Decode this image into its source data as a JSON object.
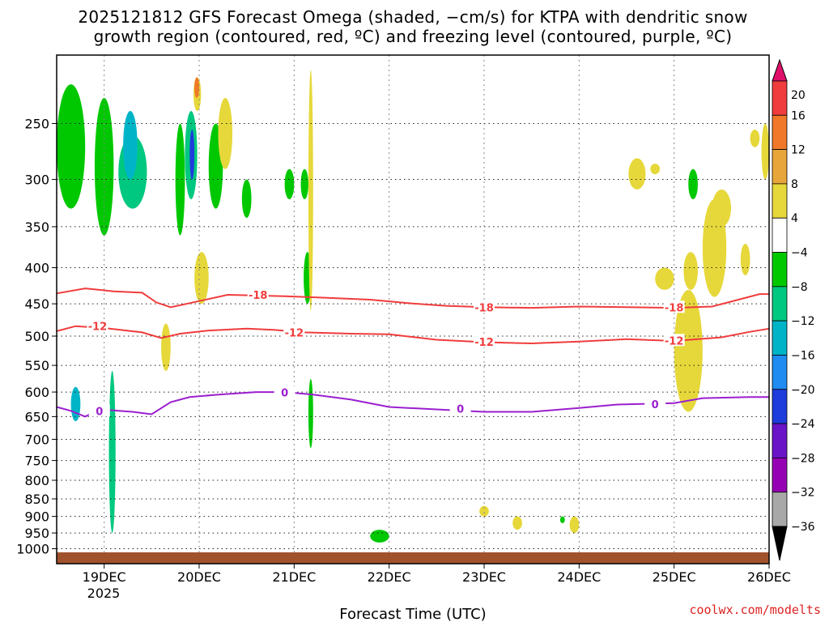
{
  "chart_data": {
    "type": "heatmap",
    "title_lines": [
      "2025121812 GFS Forecast Omega (shaded, −cm/s) for KTPA with dendritic snow",
      "growth region (contoured, red, ºC) and freezing level (contoured, purple, ºC)"
    ],
    "xlabel": "Forecast Time (UTC)",
    "year_label": "2025",
    "credit": "coolwx.com/modelts",
    "x_ticks": [
      "19DEC",
      "20DEC",
      "21DEC",
      "22DEC",
      "23DEC",
      "24DEC",
      "25DEC",
      "26DEC"
    ],
    "x_range": [
      -0.5,
      7.0
    ],
    "y_axis": {
      "scale": "log",
      "range": [
        1050,
        200
      ],
      "ticks": [
        250,
        300,
        350,
        400,
        450,
        500,
        550,
        600,
        650,
        700,
        750,
        800,
        850,
        900,
        950,
        1000
      ]
    },
    "colorbar": {
      "labels": [
        20,
        16,
        12,
        8,
        4,
        -4,
        -8,
        -12,
        -16,
        -20,
        -24,
        -28,
        -32,
        -36
      ],
      "colors": [
        "#e0106a",
        "#f03c3c",
        "#f07828",
        "#e8a63a",
        "#e6d83a",
        "#ffffff",
        "#00c800",
        "#00c880",
        "#00b4c8",
        "#1e8cf0",
        "#1e3cdc",
        "#6a14c8",
        "#9600b4",
        "#a8a8a8",
        "#000000"
      ]
    },
    "surface_color": "#a0522d",
    "contours": [
      {
        "label": "-18",
        "color": "#f03c3c",
        "points": [
          [
            -0.5,
            435
          ],
          [
            -0.2,
            428
          ],
          [
            0.1,
            432
          ],
          [
            0.4,
            434
          ],
          [
            0.55,
            448
          ],
          [
            0.7,
            455
          ],
          [
            0.9,
            449
          ],
          [
            1.3,
            437
          ],
          [
            1.6,
            438
          ],
          [
            1.9,
            439
          ],
          [
            2.3,
            441
          ],
          [
            2.8,
            444
          ],
          [
            3.2,
            449
          ],
          [
            3.6,
            453
          ],
          [
            4.0,
            455
          ],
          [
            4.5,
            456
          ],
          [
            5.0,
            454
          ],
          [
            5.5,
            455
          ],
          [
            6.0,
            456
          ],
          [
            6.4,
            454
          ],
          [
            6.9,
            436
          ],
          [
            7.0,
            436
          ]
        ],
        "label_at": [
          [
            1.62,
            437
          ],
          [
            4.0,
            455
          ],
          [
            6.0,
            455
          ]
        ]
      },
      {
        "label": "-12",
        "color": "#f03c3c",
        "points": [
          [
            -0.5,
            492
          ],
          [
            -0.3,
            484
          ],
          [
            0.0,
            487
          ],
          [
            0.4,
            494
          ],
          [
            0.6,
            503
          ],
          [
            0.8,
            496
          ],
          [
            1.1,
            491
          ],
          [
            1.5,
            488
          ],
          [
            1.8,
            490
          ],
          [
            2.1,
            494
          ],
          [
            2.6,
            496
          ],
          [
            3.0,
            497
          ],
          [
            3.5,
            506
          ],
          [
            4.0,
            510
          ],
          [
            4.5,
            512
          ],
          [
            5.0,
            509
          ],
          [
            5.5,
            505
          ],
          [
            6.0,
            508
          ],
          [
            6.5,
            502
          ],
          [
            6.8,
            493
          ],
          [
            7.0,
            488
          ]
        ],
        "label_at": [
          [
            -0.07,
            484
          ],
          [
            2.0,
            494
          ],
          [
            4.0,
            509
          ],
          [
            6.0,
            507
          ]
        ]
      },
      {
        "label": "0",
        "color": "#9b1fcf",
        "points": [
          [
            -0.5,
            630
          ],
          [
            -0.35,
            638
          ],
          [
            -0.2,
            650
          ],
          [
            -0.05,
            635
          ],
          [
            0.3,
            640
          ],
          [
            0.5,
            645
          ],
          [
            0.7,
            620
          ],
          [
            0.9,
            610
          ],
          [
            1.2,
            605
          ],
          [
            1.6,
            600
          ],
          [
            1.9,
            600
          ],
          [
            2.2,
            605
          ],
          [
            2.6,
            615
          ],
          [
            3.0,
            630
          ],
          [
            3.5,
            635
          ],
          [
            4.0,
            640
          ],
          [
            4.5,
            640
          ],
          [
            5.0,
            632
          ],
          [
            5.4,
            625
          ],
          [
            6.0,
            622
          ],
          [
            6.3,
            612
          ],
          [
            6.8,
            610
          ],
          [
            7.0,
            610
          ]
        ],
        "label_at": [
          [
            -0.05,
            638
          ],
          [
            1.9,
            601
          ],
          [
            3.75,
            633
          ],
          [
            5.8,
            624
          ]
        ]
      }
    ],
    "shaded_regions": [
      {
        "x": [
          -0.5,
          -0.2
        ],
        "p": [
          220,
          330
        ],
        "value": -6
      },
      {
        "x": [
          -0.1,
          0.1
        ],
        "p": [
          230,
          360
        ],
        "value": -6
      },
      {
        "x": [
          0.15,
          0.45
        ],
        "p": [
          260,
          330
        ],
        "value": -10
      },
      {
        "x": [
          0.2,
          0.35
        ],
        "p": [
          240,
          300
        ],
        "value": -14
      },
      {
        "x": [
          0.75,
          0.85
        ],
        "p": [
          250,
          360
        ],
        "value": -6
      },
      {
        "x": [
          0.85,
          0.98
        ],
        "p": [
          240,
          320
        ],
        "value": -8
      },
      {
        "x": [
          0.9,
          0.95
        ],
        "p": [
          255,
          300
        ],
        "value": -22
      },
      {
        "x": [
          0.94,
          1.02
        ],
        "p": [
          215,
          240
        ],
        "value": 6
      },
      {
        "x": [
          0.95,
          1.0
        ],
        "p": [
          215,
          230
        ],
        "value": 14
      },
      {
        "x": [
          0.95,
          1.1
        ],
        "p": [
          380,
          450
        ],
        "value": 6
      },
      {
        "x": [
          1.1,
          1.25
        ],
        "p": [
          250,
          330
        ],
        "value": -6
      },
      {
        "x": [
          1.2,
          1.35
        ],
        "p": [
          230,
          290
        ],
        "value": 5
      },
      {
        "x": [
          1.45,
          1.55
        ],
        "p": [
          300,
          340
        ],
        "value": -6
      },
      {
        "x": [
          1.9,
          2.0
        ],
        "p": [
          290,
          320
        ],
        "value": -6
      },
      {
        "x": [
          2.07,
          2.15
        ],
        "p": [
          290,
          320
        ],
        "value": -6
      },
      {
        "x": [
          2.1,
          2.18
        ],
        "p": [
          380,
          450
        ],
        "value": -6
      },
      {
        "x": [
          2.15,
          2.2
        ],
        "p": [
          210,
          460
        ],
        "value": 5
      },
      {
        "x": [
          2.15,
          2.2
        ],
        "p": [
          575,
          720
        ],
        "value": -6
      },
      {
        "x": [
          -0.35,
          -0.25
        ],
        "p": [
          590,
          660
        ],
        "value": -12
      },
      {
        "x": [
          0.05,
          0.12
        ],
        "p": [
          560,
          950
        ],
        "value": -10
      },
      {
        "x": [
          0.6,
          0.7
        ],
        "p": [
          480,
          560
        ],
        "value": 5
      },
      {
        "x": [
          2.8,
          3.0
        ],
        "p": [
          940,
          980
        ],
        "value": -6
      },
      {
        "x": [
          3.95,
          4.05
        ],
        "p": [
          870,
          900
        ],
        "value": 5
      },
      {
        "x": [
          4.3,
          4.4
        ],
        "p": [
          900,
          940
        ],
        "value": 5
      },
      {
        "x": [
          4.8,
          4.85
        ],
        "p": [
          900,
          920
        ],
        "value": -6
      },
      {
        "x": [
          4.9,
          5.0
        ],
        "p": [
          900,
          950
        ],
        "value": 5
      },
      {
        "x": [
          5.52,
          5.7
        ],
        "p": [
          280,
          310
        ],
        "value": 5
      },
      {
        "x": [
          5.75,
          5.85
        ],
        "p": [
          285,
          295
        ],
        "value": 5
      },
      {
        "x": [
          6.15,
          6.25
        ],
        "p": [
          290,
          320
        ],
        "value": -6
      },
      {
        "x": [
          5.8,
          6.0
        ],
        "p": [
          400,
          430
        ],
        "value": 5
      },
      {
        "x": [
          6.0,
          6.3
        ],
        "p": [
          430,
          640
        ],
        "value": 6
      },
      {
        "x": [
          6.1,
          6.25
        ],
        "p": [
          380,
          430
        ],
        "value": 5
      },
      {
        "x": [
          6.3,
          6.55
        ],
        "p": [
          320,
          440
        ],
        "value": 5
      },
      {
        "x": [
          6.4,
          6.6
        ],
        "p": [
          310,
          350
        ],
        "value": 5
      },
      {
        "x": [
          6.7,
          6.8
        ],
        "p": [
          370,
          410
        ],
        "value": 5
      },
      {
        "x": [
          6.8,
          6.9
        ],
        "p": [
          255,
          270
        ],
        "value": 5
      },
      {
        "x": [
          6.92,
          7.0
        ],
        "p": [
          250,
          300
        ],
        "value": 5
      }
    ]
  }
}
